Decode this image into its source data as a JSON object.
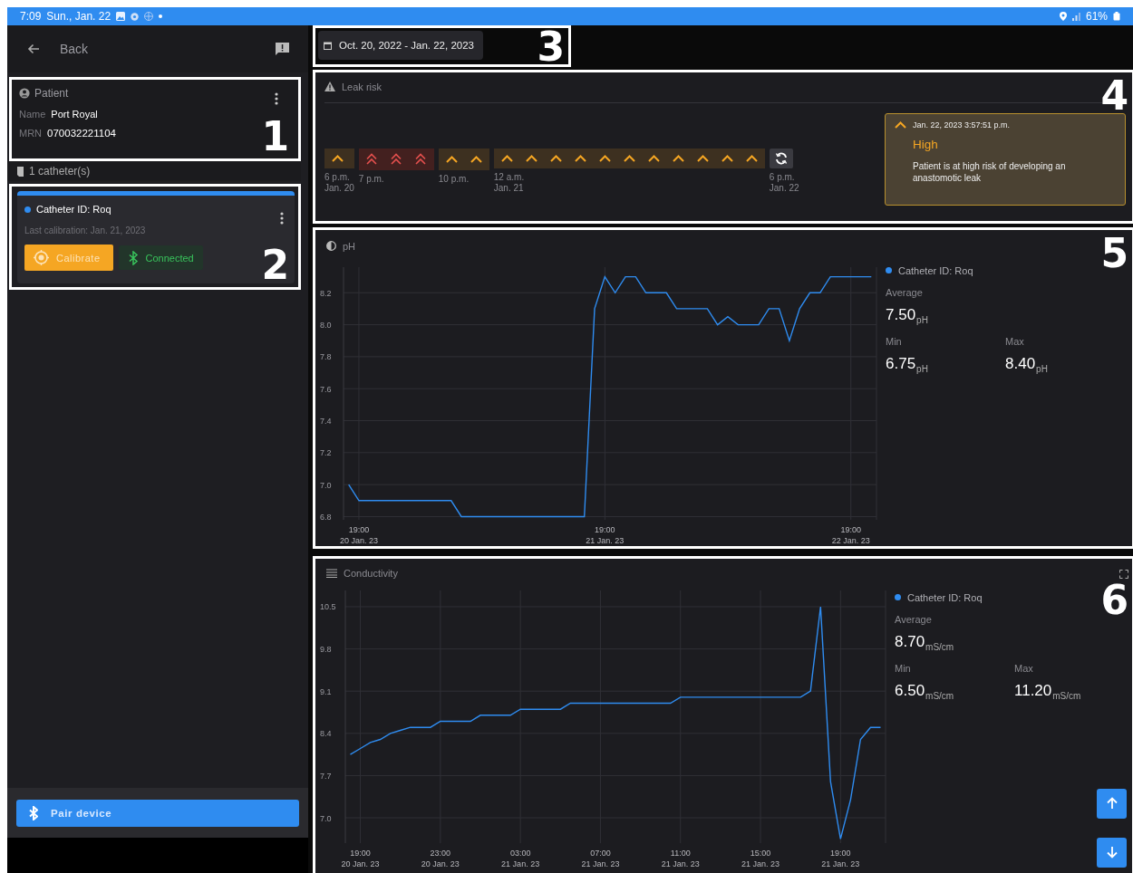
{
  "status_bar": {
    "time": "7:09",
    "date": "Sun., Jan. 22",
    "battery": "61%"
  },
  "sidebar": {
    "back_label": "Back",
    "patient": {
      "callout": "1",
      "title": "Patient",
      "fields": [
        {
          "label": "Name",
          "value": "Port Royal"
        },
        {
          "label": "MRN",
          "value": "070032221104"
        }
      ]
    },
    "catheter_count": "1 catheter(s)",
    "catheters": [
      {
        "callout": "2",
        "name": "Catheter ID: Roq",
        "color": "#2f8cf0",
        "last_calibration": "Last calibration: Jan. 21, 2023",
        "calibrate_label": "Calibrate",
        "status": "Connected",
        "connected": true
      }
    ],
    "pair_button": "Pair device"
  },
  "date_range": {
    "callout": "3",
    "label": "Oct. 20, 2022 - Jan. 22, 2023"
  },
  "leak_risk": {
    "callout": "4",
    "title": "Leak risk",
    "groups": [
      {
        "time": "6 p.m.",
        "date": "Jan. 20",
        "cells": [
          {
            "kind": "moderate"
          }
        ]
      },
      {
        "time": "7 p.m.",
        "cells": [
          {
            "kind": "high"
          },
          {
            "kind": "high"
          },
          {
            "kind": "high"
          }
        ]
      },
      {
        "time": "10 p.m.",
        "cells": [
          {
            "kind": "moderate"
          },
          {
            "kind": "moderate"
          }
        ]
      },
      {
        "time": "12 a.m.",
        "date": "Jan. 21",
        "cells": [
          {
            "kind": "moderate"
          },
          {
            "kind": "moderate"
          },
          {
            "kind": "moderate"
          },
          {
            "kind": "moderate"
          },
          {
            "kind": "moderate"
          },
          {
            "kind": "moderate"
          },
          {
            "kind": "moderate"
          },
          {
            "kind": "moderate"
          },
          {
            "kind": "moderate"
          },
          {
            "kind": "moderate"
          },
          {
            "kind": "moderate"
          }
        ]
      }
    ],
    "end_label": {
      "time": "6 p.m.",
      "date": "Jan. 22"
    },
    "alert": {
      "timestamp": "Jan. 22, 2023 3:57:51 p.m.",
      "level_label": "High",
      "message": "Patient is at high risk of developing an anastomotic leak"
    }
  },
  "ph": {
    "callout": "5",
    "title": "pH",
    "chart_data": {
      "type": "line",
      "categories": [
        null,
        "19:00\n20 Jan. 23",
        null,
        null,
        null,
        null,
        null,
        null,
        null,
        null,
        null,
        null,
        null,
        null,
        null,
        null,
        null,
        null,
        null,
        null,
        null,
        null,
        null,
        null,
        null,
        "19:00\n21 Jan. 23",
        null,
        null,
        null,
        null,
        null,
        null,
        null,
        null,
        null,
        null,
        null,
        null,
        null,
        null,
        null,
        null,
        null,
        null,
        null,
        null,
        null,
        null,
        null,
        "19:00\n22 Jan. 23",
        null,
        null
      ],
      "series": [
        {
          "name": "Catheter ID: Roq",
          "color": "#2f8cf0",
          "values": [
            7.0,
            6.9,
            6.9,
            6.9,
            6.9,
            6.9,
            6.9,
            6.9,
            6.9,
            6.9,
            6.9,
            6.8,
            6.8,
            6.8,
            6.8,
            6.8,
            6.8,
            6.8,
            6.8,
            6.8,
            6.8,
            6.8,
            6.8,
            6.8,
            8.1,
            8.3,
            8.2,
            8.3,
            8.3,
            8.2,
            8.2,
            8.2,
            8.1,
            8.1,
            8.1,
            8.1,
            8.0,
            8.05,
            8.0,
            8.0,
            8.0,
            8.1,
            8.1,
            7.9,
            8.1,
            8.2,
            8.2,
            8.3,
            8.3,
            8.3,
            8.3,
            8.3
          ]
        }
      ],
      "ylim": [
        6.78,
        8.36
      ],
      "grid": true,
      "yticks": [
        {
          "value": 6.8,
          "label": "6.8"
        },
        {
          "value": 7.0,
          "label": "7.0"
        },
        {
          "value": 7.2,
          "label": "7.2"
        },
        {
          "value": 7.4,
          "label": "7.4"
        },
        {
          "value": 7.6,
          "label": "7.6"
        },
        {
          "value": 7.8,
          "label": "7.8"
        },
        {
          "value": 8.0,
          "label": "8.0"
        },
        {
          "value": 8.2,
          "label": "8.2"
        }
      ]
    },
    "stats": [
      {
        "label": "Average",
        "value": "7.50",
        "unit": "pH"
      },
      {
        "label": "Min",
        "value": "6.75",
        "unit": "pH"
      },
      {
        "label": "Max",
        "value": "8.40",
        "unit": "pH"
      }
    ]
  },
  "conductivity": {
    "callout": "6",
    "title": "Conductivity",
    "chart_data": {
      "type": "line",
      "categories": [
        null,
        "19:00\n20 Jan. 23",
        null,
        null,
        null,
        null,
        null,
        null,
        null,
        "23:00\n20 Jan. 23",
        null,
        null,
        null,
        null,
        null,
        null,
        null,
        "03:00\n21 Jan. 23",
        null,
        null,
        null,
        null,
        null,
        null,
        null,
        "07:00\n21 Jan. 23",
        null,
        null,
        null,
        null,
        null,
        null,
        null,
        "11:00\n21 Jan. 23",
        null,
        null,
        null,
        null,
        null,
        null,
        null,
        "15:00\n21 Jan. 23",
        null,
        null,
        null,
        null,
        null,
        null,
        null,
        "19:00\n21 Jan. 23",
        null,
        null,
        null,
        null
      ],
      "series": [
        {
          "name": "Catheter ID: Roq",
          "color": "#2f8cf0",
          "values": [
            8.05,
            8.15,
            8.25,
            8.3,
            8.4,
            8.45,
            8.5,
            8.5,
            8.5,
            8.6,
            8.6,
            8.6,
            8.6,
            8.7,
            8.7,
            8.7,
            8.7,
            8.8,
            8.8,
            8.8,
            8.8,
            8.8,
            8.9,
            8.9,
            8.9,
            8.9,
            8.9,
            8.9,
            8.9,
            8.9,
            8.9,
            8.9,
            8.9,
            9.0,
            9.0,
            9.0,
            9.0,
            9.0,
            9.0,
            9.0,
            9.0,
            9.0,
            9.0,
            9.0,
            9.0,
            9.0,
            9.1,
            10.5,
            7.6,
            6.65,
            7.3,
            8.3,
            8.5,
            8.5
          ]
        }
      ],
      "ylim": [
        6.58,
        10.77
      ],
      "grid": true,
      "yticks": [
        {
          "value": 7.0,
          "label": "7.0"
        },
        {
          "value": 7.7,
          "label": "7.7"
        },
        {
          "value": 8.4,
          "label": "8.4"
        },
        {
          "value": 9.1,
          "label": "9.1"
        },
        {
          "value": 9.8,
          "label": "9.8"
        },
        {
          "value": 10.5,
          "label": "10.5"
        }
      ]
    },
    "stats": [
      {
        "label": "Average",
        "value": "8.70",
        "unit": "mS/cm"
      },
      {
        "label": "Min",
        "value": "6.50",
        "unit": "mS/cm"
      },
      {
        "label": "Max",
        "value": "11.20",
        "unit": "mS/cm"
      }
    ]
  }
}
